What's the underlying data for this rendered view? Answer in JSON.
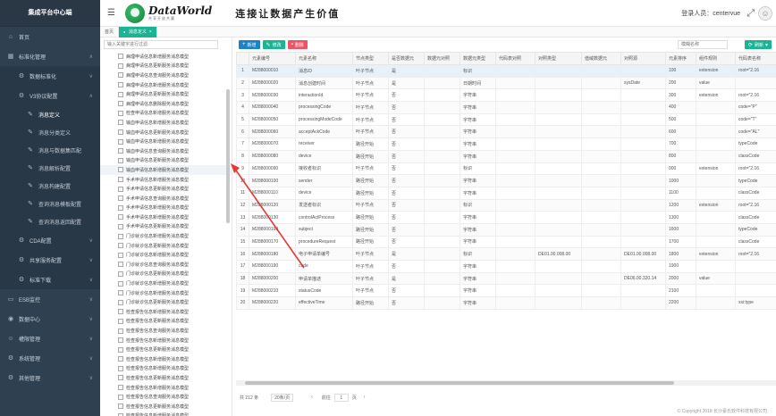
{
  "sidebar": {
    "title": "集成平台中心端",
    "items": [
      {
        "label": "首页",
        "icon": "home-icon"
      },
      {
        "label": "标准化管理",
        "icon": "building-icon"
      },
      {
        "label": "数据标准化",
        "icon": "gear-icon"
      },
      {
        "label": "V3协议配置",
        "icon": "gear-icon"
      },
      {
        "label": "消息定义"
      },
      {
        "label": "消息分类定义"
      },
      {
        "label": "消息与数据集匹配"
      },
      {
        "label": "消息解析配置"
      },
      {
        "label": "消息构建配置"
      },
      {
        "label": "查询消息模板配置"
      },
      {
        "label": "查询消息返回配置"
      },
      {
        "label": "CDA配置",
        "icon": "gear-icon"
      },
      {
        "label": "共享服务配置",
        "icon": "gear-icon"
      },
      {
        "label": "标准下载",
        "icon": "gear-icon"
      },
      {
        "label": "ESB监控",
        "icon": "monitor-icon"
      },
      {
        "label": "数据中心",
        "icon": "database-icon"
      },
      {
        "label": "權限管理",
        "icon": "user-icon"
      },
      {
        "label": "系统管理",
        "icon": "gear-icon"
      },
      {
        "label": "其他管理",
        "icon": "gear-icon"
      }
    ]
  },
  "header": {
    "brand_en": "DataWorld",
    "brand_cn": "共享开放共赢",
    "slogan": "连接让数据产生价值",
    "user_label": "登录人员：centervue"
  },
  "tabs": [
    {
      "label": "首页"
    },
    {
      "label": "消息定义"
    }
  ],
  "tree": {
    "search_placeholder": "输入关键字进行过滤",
    "items": [
      "病理申请信息新增服务消息模型",
      "病理申请信息更新服务消息模型",
      "病理申请信息查询服务消息模型",
      "病理申请信息新增服务消息模型",
      "病理申请信息更新服务消息模型",
      "病理申请信息删除服务消息模型",
      "检查申请信息新增服务消息模型",
      "输血申请信息新增服务消息模型",
      "输血申请信息更新服务消息模型",
      "输血申请信息新增服务消息模型",
      "输血申请信息查询服务消息模型",
      "输血申请信息更新服务消息模型",
      "输血申请信息新增服务消息模型",
      "手术申请信息新增服务消息模型",
      "手术申请信息更新服务消息模型",
      "手术申请信息查询服务消息模型",
      "手术申请信息新增服务消息模型",
      "手术申请信息新增服务消息模型",
      "手术申请信息更新服务消息模型",
      "门诊就诊信息新增服务消息模型",
      "门诊就诊信息更新服务消息模型",
      "门诊就诊信息新增服务消息模型",
      "门诊就诊信息查询服务消息模型",
      "门诊就诊信息更新服务消息模型",
      "门诊就诊信息新增服务消息模型",
      "门诊就诊信息新增服务消息模型",
      "门诊就诊信息更新服务消息模型",
      "检查报告信息新增服务消息模型",
      "检查报告信息更新服务消息模型",
      "检查报告信息查询服务消息模型",
      "检查报告信息新增服务消息模型",
      "检查报告信息更新服务消息模型",
      "检查报告信息新增服务消息模型",
      "检查报告信息新增服务消息模型",
      "检查报告信息更新服务消息模型",
      "检查报告信息新增服务消息模型",
      "检查报告信息查询服务消息模型",
      "检查报告信息更新服务消息模型",
      "检查报告信息新增服务消息模型"
    ]
  },
  "toolbar": {
    "add_label": "新增",
    "edit_label": "修改",
    "delete_label": "删除",
    "search_placeholder": "模糊名称",
    "refresh_label": "刷新"
  },
  "grid": {
    "columns": [
      "",
      "元素编号",
      "元素名称",
      "节点类型",
      "是否数据元",
      "数据元对照",
      "数据元类型",
      "代码表对照",
      "对照类型",
      "值域数据元",
      "对照源",
      "元素排序",
      "组件规则",
      "代码表名称"
    ],
    "rows": [
      [
        "1",
        "M288000010",
        "消息ID",
        "叶子节点",
        "是",
        "",
        "标识",
        "",
        "",
        "",
        "",
        "100",
        "extension",
        "root=\"2.16"
      ],
      [
        "2",
        "M288000020",
        "消息创建时间",
        "叶子节点",
        "是",
        "",
        "日期时间",
        "",
        "",
        "",
        "sysDate",
        "200",
        "value",
        ""
      ],
      [
        "3",
        "M288000030",
        "interactionId",
        "叶子节点",
        "否",
        "",
        "字符串",
        "",
        "",
        "",
        "",
        "300",
        "extension",
        "root=\"2.16"
      ],
      [
        "4",
        "M288000040",
        "processingCode",
        "叶子节点",
        "否",
        "",
        "字符串",
        "",
        "",
        "",
        "",
        "400",
        "",
        "code=\"P\""
      ],
      [
        "5",
        "M288000050",
        "processingModeCode",
        "叶子节点",
        "否",
        "",
        "字符串",
        "",
        "",
        "",
        "",
        "500",
        "",
        "code=\"T\""
      ],
      [
        "6",
        "M288000060",
        "acceptAckCode",
        "叶子节点",
        "否",
        "",
        "字符串",
        "",
        "",
        "",
        "",
        "600",
        "",
        "code=\"AL\""
      ],
      [
        "7",
        "M288000070",
        "receiver",
        "路径开始",
        "否",
        "",
        "字符串",
        "",
        "",
        "",
        "",
        "700",
        "",
        "typeCode"
      ],
      [
        "8",
        "M288000080",
        "device",
        "路径开始",
        "否",
        "",
        "字符串",
        "",
        "",
        "",
        "",
        "800",
        "",
        "classCode"
      ],
      [
        "9",
        "M288000090",
        "接收者标识",
        "叶子节点",
        "否",
        "",
        "标识",
        "",
        "",
        "",
        "",
        "900",
        "extension",
        "root=\"2.16"
      ],
      [
        "10",
        "M288000100",
        "sender",
        "路径开始",
        "否",
        "",
        "字符串",
        "",
        "",
        "",
        "",
        "1000",
        "",
        "typeCode"
      ],
      [
        "11",
        "M288000110",
        "device",
        "路径开始",
        "否",
        "",
        "字符串",
        "",
        "",
        "",
        "",
        "1100",
        "",
        "classCode"
      ],
      [
        "12",
        "M288000120",
        "发送者标识",
        "叶子节点",
        "否",
        "",
        "标识",
        "",
        "",
        "",
        "",
        "1200",
        "extension",
        "root=\"2.16"
      ],
      [
        "13",
        "M288000130",
        "controlActProcess",
        "路径开始",
        "否",
        "",
        "字符串",
        "",
        "",
        "",
        "",
        "1300",
        "",
        "classCode"
      ],
      [
        "14",
        "M288000160",
        "subject",
        "路径开始",
        "否",
        "",
        "字符串",
        "",
        "",
        "",
        "",
        "1600",
        "",
        "typeCode"
      ],
      [
        "15",
        "M288000170",
        "procedureRequest",
        "路径开始",
        "否",
        "",
        "字符串",
        "",
        "",
        "",
        "",
        "1700",
        "",
        "classCode"
      ],
      [
        "16",
        "M288000180",
        "电子申请单编号",
        "叶子节点",
        "是",
        "",
        "标识",
        "",
        "DE01.00.008.00",
        "",
        "DE01.00.008.00",
        "1800",
        "extension",
        "root=\"2.16"
      ],
      [
        "17",
        "M288000190",
        "code",
        "叶子节点",
        "否",
        "",
        "字符串",
        "",
        "",
        "",
        "",
        "1900",
        "",
        ""
      ],
      [
        "18",
        "M288000200",
        "申请单描述",
        "叶子节点",
        "是",
        "",
        "字符串",
        "",
        "",
        "",
        "DE06.00.320.14",
        "2000",
        "value",
        ""
      ],
      [
        "19",
        "M288000210",
        "statusCode",
        "叶子节点",
        "否",
        "",
        "字符串",
        "",
        "",
        "",
        "",
        "2100",
        "",
        ""
      ],
      [
        "20",
        "M288000220",
        "effectiveTime",
        "路径开始",
        "否",
        "",
        "字符串",
        "",
        "",
        "",
        "",
        "2200",
        "",
        "xsi:type"
      ]
    ]
  },
  "pager": {
    "total": "共 212 条",
    "page_size": "20条/页",
    "prev": "前往",
    "page": "1",
    "suffix": "页"
  },
  "footer": "© Copyright 2018 长沙豪氏软件科技有限公司"
}
